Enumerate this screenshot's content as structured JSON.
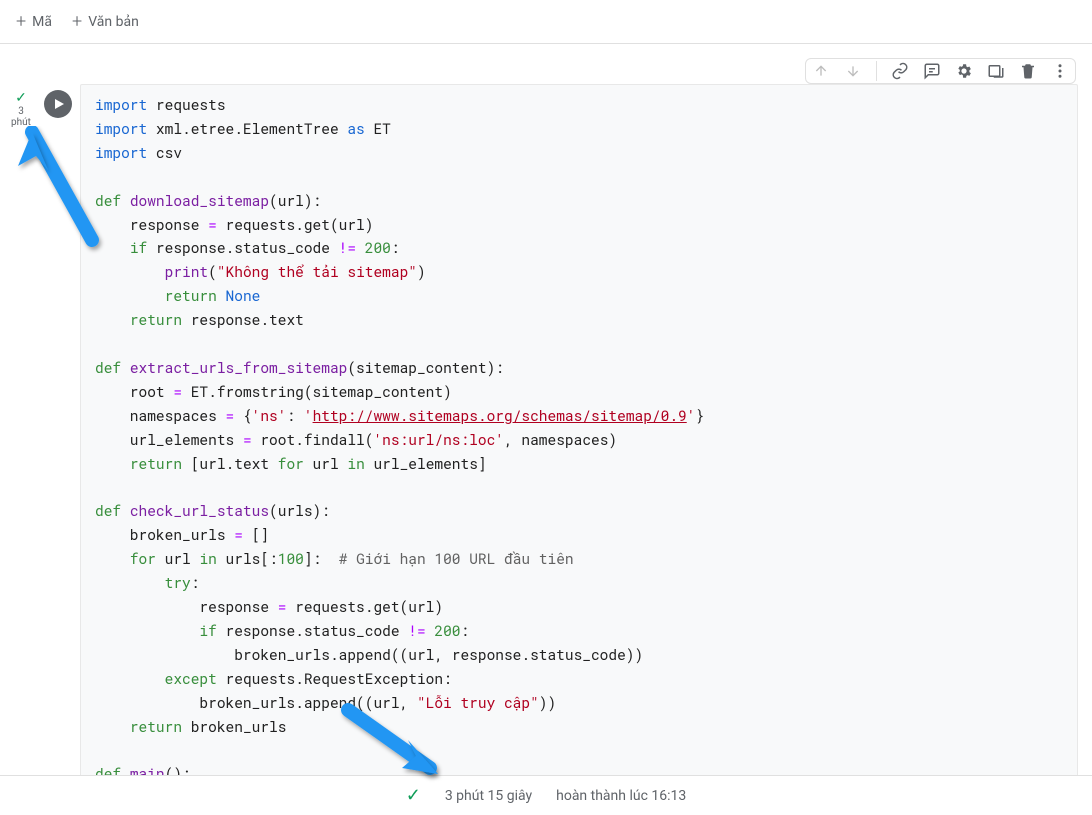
{
  "toolbar": {
    "code_label": "Mã",
    "text_label": "Văn bản"
  },
  "sidebar": {
    "line1": "3",
    "line2": "phút"
  },
  "status": {
    "duration": "3 phút 15 giây",
    "completed": "hoàn thành lúc 16:13"
  },
  "code": {
    "l1a": "import",
    "l1b": " requests",
    "l2a": "import",
    "l2b": " xml.etree.ElementTree ",
    "l2c": "as",
    "l2d": " ET",
    "l3a": "import",
    "l3b": " csv",
    "l5a": "def",
    "l5b": " ",
    "l5c": "download_sitemap",
    "l5d": "(url):",
    "l6a": "    response ",
    "l6b": "=",
    "l6c": " requests.get(url)",
    "l7a": "    ",
    "l7b": "if",
    "l7c": " response.status_code ",
    "l7d": "!=",
    "l7e": " ",
    "l7f": "200",
    "l7g": ":",
    "l8a": "        ",
    "l8b": "print",
    "l8c": "(",
    "l8d": "\"Không thể tải sitemap\"",
    "l8e": ")",
    "l9a": "        ",
    "l9b": "return",
    "l9c": " ",
    "l9d": "None",
    "l10a": "    ",
    "l10b": "return",
    "l10c": " response.text",
    "l12a": "def",
    "l12b": " ",
    "l12c": "extract_urls_from_sitemap",
    "l12d": "(sitemap_content):",
    "l13a": "    root ",
    "l13b": "=",
    "l13c": " ET.fromstring(sitemap_content)",
    "l14a": "    namespaces ",
    "l14b": "=",
    "l14c": " {",
    "l14d": "'ns'",
    "l14e": ": ",
    "l14f": "'",
    "l14g": "http://www.sitemaps.org/schemas/sitemap/0.9",
    "l14h": "'",
    "l14i": "}",
    "l15a": "    url_elements ",
    "l15b": "=",
    "l15c": " root.findall(",
    "l15d": "'ns:url/ns:loc'",
    "l15e": ", namespaces)",
    "l16a": "    ",
    "l16b": "return",
    "l16c": " [url.text ",
    "l16d": "for",
    "l16e": " url ",
    "l16f": "in",
    "l16g": " url_elements]",
    "l18a": "def",
    "l18b": " ",
    "l18c": "check_url_status",
    "l18d": "(urls):",
    "l19a": "    broken_urls ",
    "l19b": "=",
    "l19c": " []",
    "l20a": "    ",
    "l20b": "for",
    "l20c": " url ",
    "l20d": "in",
    "l20e": " urls[:",
    "l20f": "100",
    "l20g": "]:  ",
    "l20h": "# Giới hạn 100 URL đầu tiên",
    "l21a": "        ",
    "l21b": "try",
    "l21c": ":",
    "l22a": "            response ",
    "l22b": "=",
    "l22c": " requests.get(url)",
    "l23a": "            ",
    "l23b": "if",
    "l23c": " response.status_code ",
    "l23d": "!=",
    "l23e": " ",
    "l23f": "200",
    "l23g": ":",
    "l24a": "                broken_urls.append((url, response.status_code))",
    "l25a": "        ",
    "l25b": "except",
    "l25c": " requests.RequestException:",
    "l26a": "            broken_urls.append((url, ",
    "l26b": "\"Lỗi truy cập\"",
    "l26c": "))",
    "l27a": "    ",
    "l27b": "return",
    "l27c": " broken_urls",
    "l29a": "def",
    "l29b": " ",
    "l29c": "main",
    "l29d": "():"
  }
}
